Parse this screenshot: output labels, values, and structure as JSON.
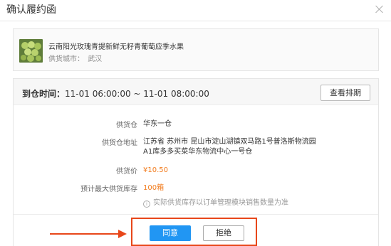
{
  "dialog": {
    "title": "确认履约函",
    "close_icon": "close-icon"
  },
  "product": {
    "name": "云南阳光玫瑰青提新鲜无籽青葡萄应季水果",
    "city_label": "供货城市：",
    "city_value": "武汉"
  },
  "order": {
    "arrival_label": "到仓时间：",
    "arrival_value": "11-01 06:00:00 ~ 11-01 08:00:00",
    "schedule_button": "查看排期",
    "fields": [
      {
        "key": "供货仓",
        "value": "华东一仓"
      },
      {
        "key": "供货仓地址",
        "value_line1": "江苏省 苏州市 昆山市淀山湖镇双马路1号普洛斯物流园",
        "value_line2": "A1库多多买菜华东物流中心一号仓"
      },
      {
        "key": "供货价",
        "value": "¥10.50"
      },
      {
        "key": "预计最大供货库存",
        "value": "100箱"
      }
    ],
    "hint": "实际供货库存以订单管理模块销售数量为准",
    "hint_icon": "info-icon"
  },
  "actions": {
    "agree": "同意",
    "reject": "拒绝"
  },
  "colors": {
    "primary": "#2196f3",
    "accent_orange": "#f27c1e",
    "annotation_red": "#e8471a"
  }
}
